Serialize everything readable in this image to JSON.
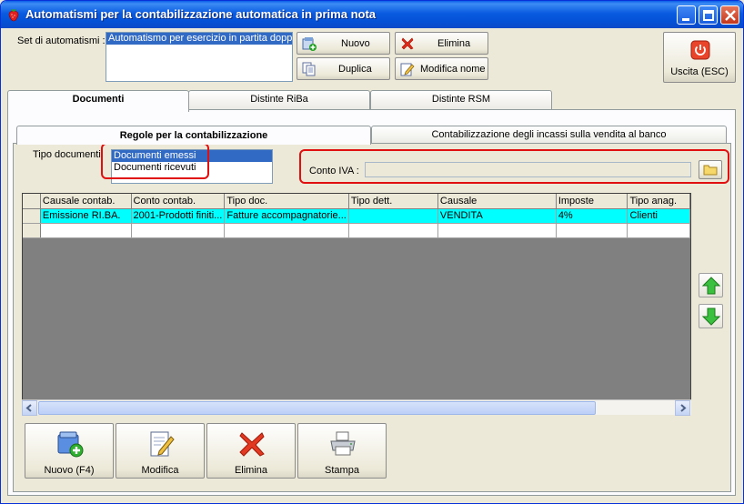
{
  "window": {
    "title": "Automatismi per la contabilizzazione automatica in prima nota",
    "app_icon": "strawberry-icon"
  },
  "top": {
    "set_label": "Set di automatismi :",
    "set_items": [
      "Automatismo per esercizio in partita doppia"
    ],
    "buttons": {
      "nuovo": "Nuovo",
      "elimina": "Elimina",
      "duplica": "Duplica",
      "modifica_nome": "Modifica nome",
      "uscita": "Uscita (ESC)"
    }
  },
  "tabs": [
    "Documenti",
    "Distinte RiBa",
    "Distinte RSM"
  ],
  "subtabs": [
    "Regole per la contabilizzazione",
    "Contabilizzazione degli incassi sulla vendita al banco"
  ],
  "filters": {
    "tipo_documenti_label": "Tipo documenti",
    "tipo_documenti_items": [
      "Documenti emessi",
      "Documenti ricevuti"
    ],
    "conto_iva_label": "Conto IVA :",
    "conto_iva_value": ""
  },
  "grid": {
    "columns": [
      "Causale contab.",
      "Conto contab.",
      "Tipo doc.",
      "Tipo dett.",
      "Causale",
      "Imposte",
      "Tipo anag."
    ],
    "rows": [
      [
        "Emissione RI.BA.",
        "2001-Prodotti finiti...",
        "Fatture accompagnatorie...",
        "",
        "VENDITA",
        "4%",
        "Clienti"
      ]
    ]
  },
  "bottom_buttons": {
    "nuovo": "Nuovo (F4)",
    "modifica": "Modifica",
    "elimina": "Elimina",
    "stampa": "Stampa"
  },
  "colors": {
    "selected_row": "#00ffff",
    "selection": "#316ac5",
    "highlight_outline": "#e01010"
  }
}
